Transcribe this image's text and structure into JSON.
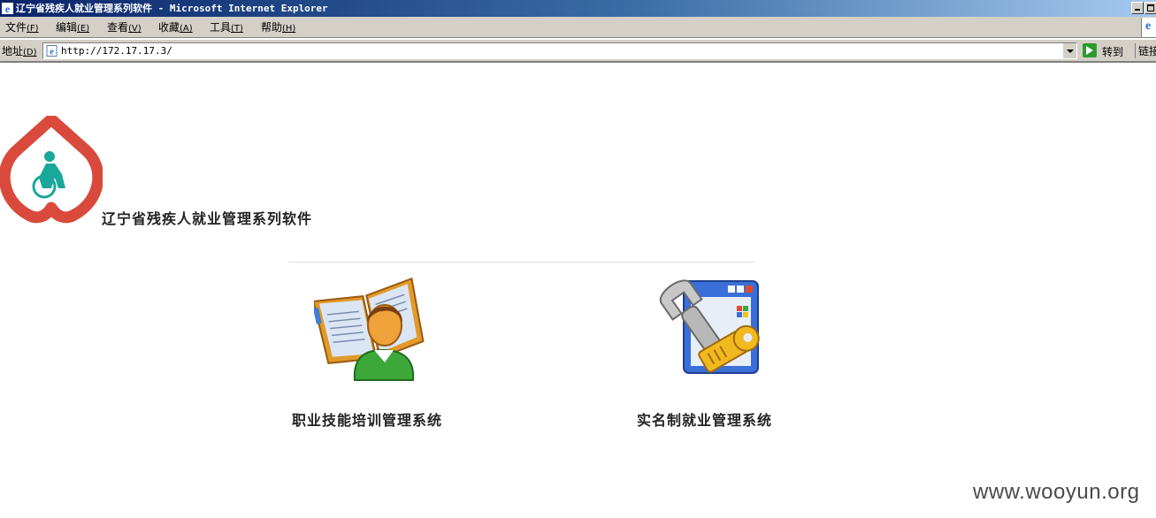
{
  "window": {
    "title": "辽宁省残疾人就业管理系列软件 - Microsoft Internet Explorer"
  },
  "menu": [
    {
      "label": "文件",
      "accel": "(F)"
    },
    {
      "label": "编辑",
      "accel": "(E)"
    },
    {
      "label": "查看",
      "accel": "(V)"
    },
    {
      "label": "收藏",
      "accel": "(A)"
    },
    {
      "label": "工具",
      "accel": "(T)"
    },
    {
      "label": "帮助",
      "accel": "(H)"
    }
  ],
  "address": {
    "label": "地址",
    "accel": "(D)",
    "url": "http://172.17.17.3/",
    "go_label": "转到",
    "links_label": "链接"
  },
  "page": {
    "site_title": "辽宁省残疾人就业管理系列软件",
    "tiles": [
      {
        "label": "职业技能培训管理系统",
        "icon": "reader-book-icon"
      },
      {
        "label": "实名制就业管理系统",
        "icon": "wrench-settings-icon"
      }
    ],
    "watermark": "www.wooyun.org"
  },
  "colors": {
    "titlebar_start": "#0a246a",
    "titlebar_end": "#a6caf0",
    "chrome": "#d4d0c8",
    "logo_red": "#d94a3c",
    "logo_teal": "#1aa89a"
  }
}
